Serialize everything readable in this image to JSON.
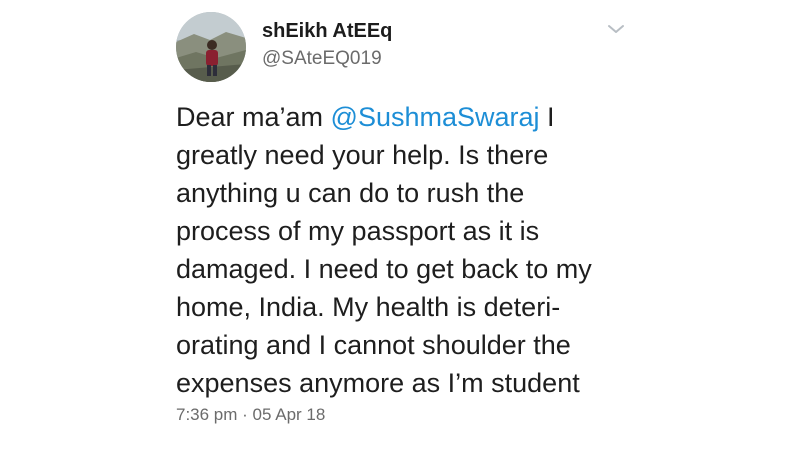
{
  "user": {
    "display_name": "shEikh AtEEq",
    "handle": "@SAteEQ019",
    "avatar_icon": "profile-photo"
  },
  "menu": {
    "icon": "chevron-down-icon"
  },
  "tweet": {
    "lines": [
      {
        "before": "Dear ma’am ",
        "mention": "@SushmaSwaraj",
        "after": " I"
      },
      {
        "text": "greatly need your help. Is there"
      },
      {
        "text": "anything u can do to rush the"
      },
      {
        "text": "process of my passport as it is"
      },
      {
        "text": "damaged. I need to get back to my"
      },
      {
        "text": "home, India. My health is deteri-"
      },
      {
        "text": "orating and I cannot shoulder the"
      },
      {
        "text": "expenses anymore as I’m student"
      }
    ],
    "timestamp": "7:36 pm · 05 Apr 18"
  },
  "colors": {
    "mention": "#1d8ed6",
    "secondary_text": "#6b6b6b",
    "primary_text": "#1c1c1c"
  }
}
